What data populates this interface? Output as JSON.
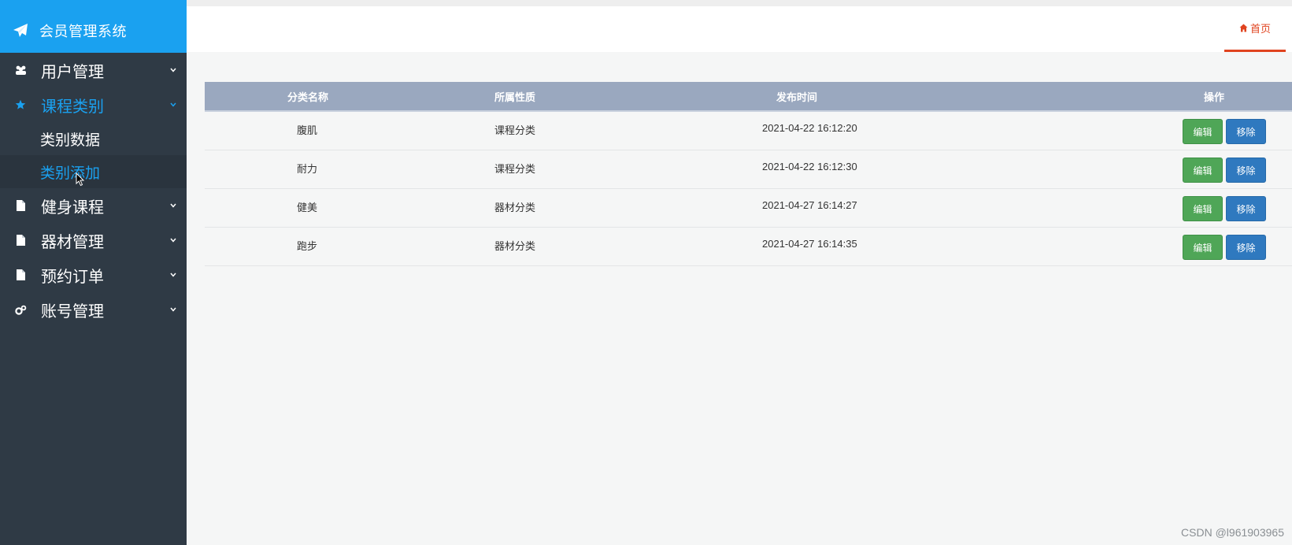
{
  "brand": {
    "title": "会员管理系统",
    "icon": "paper-plane-icon"
  },
  "sidebar": {
    "items": [
      {
        "label": "用户管理",
        "icon": "users-icon"
      },
      {
        "label": "课程类别",
        "icon": "star-icon"
      },
      {
        "label": "健身课程",
        "icon": "file-icon"
      },
      {
        "label": "器材管理",
        "icon": "file-icon"
      },
      {
        "label": "预约订单",
        "icon": "file-icon"
      },
      {
        "label": "账号管理",
        "icon": "gears-icon"
      }
    ],
    "submenu": [
      {
        "label": "类别数据"
      },
      {
        "label": "类别添加"
      }
    ]
  },
  "header": {
    "home_tab": "首页",
    "home_icon": "home-icon"
  },
  "table": {
    "headers": [
      "分类名称",
      "所属性质",
      "发布时间",
      "操作"
    ],
    "rows": [
      {
        "name": "腹肌",
        "type": "课程分类",
        "time": "2021-04-22 16:12:20"
      },
      {
        "name": "耐力",
        "type": "课程分类",
        "time": "2021-04-22 16:12:30"
      },
      {
        "name": "健美",
        "type": "器材分类",
        "time": "2021-04-27 16:14:27"
      },
      {
        "name": "跑步",
        "type": "器材分类",
        "time": "2021-04-27 16:14:35"
      }
    ],
    "edit_label": "编辑",
    "delete_label": "移除"
  },
  "colors": {
    "sidebar": "#2f3a45",
    "brand": "#1aa1f0",
    "accent": "#1aa1f0",
    "home_tab": "#e0431f",
    "edit": "#4fa657",
    "delete": "#2f79bf"
  },
  "watermark": "CSDN @l961903965"
}
